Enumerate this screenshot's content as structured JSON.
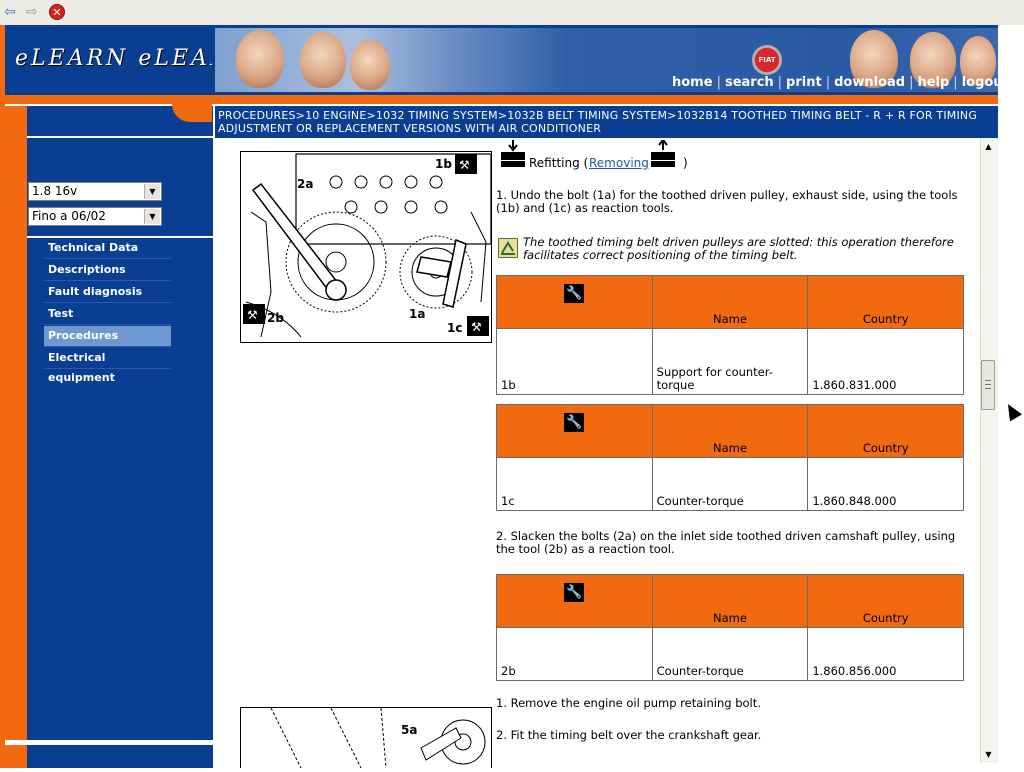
{
  "browser": {
    "back_icon": "back-arrow-icon",
    "forward_icon": "forward-arrow-icon",
    "stop_icon": "stop-icon",
    "stop_glyph": "✕"
  },
  "header": {
    "logo_text": "eLEARN eLEARN",
    "brand_badge": "FIAT",
    "nav": [
      "home",
      "search",
      "print",
      "download",
      "help",
      "logout"
    ],
    "nav_separator": "|"
  },
  "breadcrumb": "PROCEDURES>10 ENGINE>1032 TIMING SYSTEM>1032B BELT TIMING SYSTEM>1032B14 TOOTHED TIMING BELT - R + R FOR TIMING ADJUSTMENT OR REPLACEMENT VERSIONS WITH AIR CONDITIONER",
  "sidebar": {
    "model_select": "1.8 16v",
    "date_select": "Fino a 06/02",
    "items": [
      {
        "label": "Technical Data",
        "active": false
      },
      {
        "label": "Descriptions",
        "active": false
      },
      {
        "label": "Fault diagnosis",
        "active": false
      },
      {
        "label": "Test",
        "active": false
      },
      {
        "label": "Procedures",
        "active": true
      },
      {
        "label": "Electrical equipment",
        "active": false
      }
    ]
  },
  "content": {
    "refit_label": "Refitting (",
    "removing_link": "Removing",
    "refit_close": ")",
    "step_1": "1. Undo the bolt (1a) for the toothed driven pulley, exhaust side, using the tools (1b) and (1c) as reaction tools.",
    "note": "The toothed timing belt driven pulleys are slotted: this operation therefore facilitates correct positioning of the timing belt.",
    "step_2": "2. Slacken the bolts (2a) on the inlet side toothed driven camshaft pulley, using the tool (2b) as a reaction tool.",
    "step_3": "1. Remove the engine oil pump retaining bolt.",
    "step_4": "2. Fit the timing belt over the crankshaft gear.",
    "figure_1_labels": [
      "1b",
      "2a",
      "2b",
      "1a",
      "1c"
    ],
    "figure_2_labels": [
      "5a"
    ],
    "table_headers": {
      "name": "Name",
      "country": "Country"
    },
    "wrench_glyph": "🔧",
    "tools": [
      {
        "code": "1b",
        "name": "Support for counter-torque",
        "country": "1.860.831.000"
      },
      {
        "code": "1c",
        "name": "Counter-torque",
        "country": "1.860.848.000"
      },
      {
        "code": "2b",
        "name": "Counter-torque",
        "country": "1.860.856.000"
      }
    ]
  },
  "colors": {
    "brand_blue": "#0a3e92",
    "brand_orange": "#f26a10",
    "active_item": "#6f98d0",
    "link": "#1a5ea8"
  }
}
